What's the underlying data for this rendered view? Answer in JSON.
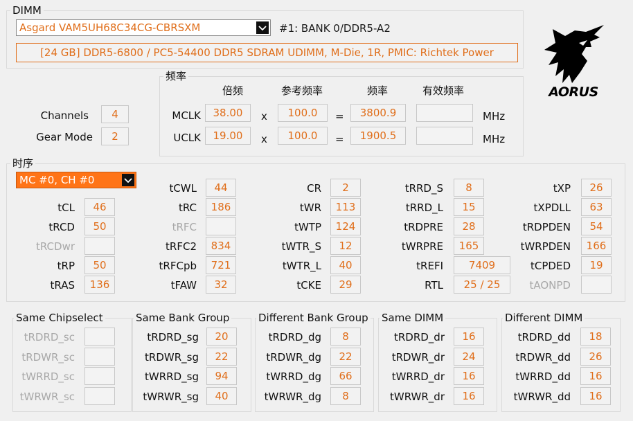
{
  "dimm": {
    "title": "DIMM",
    "module_select": "Asgard VAM5UH68C34CG-CBRSXM",
    "slot": "#1: BANK 0/DDR5-A2",
    "description": "[24 GB] DDR5-6800 / PC5-54400 DDR5 SDRAM UDIMM, M-Die, 1R, PMIC: Richtek Power"
  },
  "logo": {
    "text": "AORUS"
  },
  "channels": {
    "label": "Channels",
    "value": "4"
  },
  "gear_mode": {
    "label": "Gear Mode",
    "value": "2"
  },
  "freq": {
    "title": "频率",
    "headers": [
      "倍频",
      "参考频率",
      "频率",
      "有效频率"
    ],
    "rows": [
      {
        "label": "MCLK",
        "mult": "38.00",
        "x": "x",
        "ref": "100.0",
        "eq": "=",
        "freq": "3800.9",
        "eff": "",
        "unit": "MHz"
      },
      {
        "label": "UCLK",
        "mult": "19.00",
        "x": "x",
        "ref": "100.0",
        "eq": "=",
        "freq": "1900.5",
        "eff": "",
        "unit": "MHz"
      }
    ]
  },
  "timings": {
    "title": "时序",
    "mc_select": "MC #0, CH #0",
    "col1": [
      {
        "label": "tCL",
        "value": "46",
        "enabled": true
      },
      {
        "label": "tRCD",
        "value": "50",
        "enabled": true
      },
      {
        "label": "tRCDwr",
        "value": "",
        "enabled": false
      },
      {
        "label": "tRP",
        "value": "50",
        "enabled": true
      },
      {
        "label": "tRAS",
        "value": "136",
        "enabled": true
      }
    ],
    "col2": [
      {
        "label": "tCWL",
        "value": "44",
        "enabled": true
      },
      {
        "label": "tRC",
        "value": "186",
        "enabled": true
      },
      {
        "label": "tRFC",
        "value": "",
        "enabled": false
      },
      {
        "label": "tRFC2",
        "value": "834",
        "enabled": true
      },
      {
        "label": "tRFCpb",
        "value": "721",
        "enabled": true
      },
      {
        "label": "tFAW",
        "value": "32",
        "enabled": true
      }
    ],
    "col3": [
      {
        "label": "CR",
        "value": "2",
        "enabled": true
      },
      {
        "label": "tWR",
        "value": "113",
        "enabled": true
      },
      {
        "label": "tWTP",
        "value": "124",
        "enabled": true
      },
      {
        "label": "tWTR_S",
        "value": "12",
        "enabled": true
      },
      {
        "label": "tWTR_L",
        "value": "40",
        "enabled": true
      },
      {
        "label": "tCKE",
        "value": "29",
        "enabled": true
      }
    ],
    "col4": [
      {
        "label": "tRRD_S",
        "value": "8",
        "enabled": true
      },
      {
        "label": "tRRD_L",
        "value": "15",
        "enabled": true
      },
      {
        "label": "tRDPRE",
        "value": "28",
        "enabled": true
      },
      {
        "label": "tWRPRE",
        "value": "165",
        "enabled": true
      },
      {
        "label": "tREFI",
        "value": "7409",
        "enabled": true
      },
      {
        "label": "RTL",
        "value": "25 / 25",
        "enabled": true
      }
    ],
    "col5": [
      {
        "label": "tXP",
        "value": "26",
        "enabled": true
      },
      {
        "label": "tXPDLL",
        "value": "63",
        "enabled": true
      },
      {
        "label": "tRDPDEN",
        "value": "54",
        "enabled": true
      },
      {
        "label": "tWRPDEN",
        "value": "166",
        "enabled": true
      },
      {
        "label": "tCPDED",
        "value": "19",
        "enabled": true
      },
      {
        "label": "tAONPD",
        "value": "",
        "enabled": false
      }
    ]
  },
  "turnaround": [
    {
      "title": "Same Chipselect",
      "rows": [
        {
          "label": "tRDRD_sc",
          "value": "",
          "enabled": false
        },
        {
          "label": "tRDWR_sc",
          "value": "",
          "enabled": false
        },
        {
          "label": "tWRRD_sc",
          "value": "",
          "enabled": false
        },
        {
          "label": "tWRWR_sc",
          "value": "",
          "enabled": false
        }
      ]
    },
    {
      "title": "Same Bank Group",
      "rows": [
        {
          "label": "tRDRD_sg",
          "value": "20",
          "enabled": true
        },
        {
          "label": "tRDWR_sg",
          "value": "22",
          "enabled": true
        },
        {
          "label": "tWRRD_sg",
          "value": "94",
          "enabled": true
        },
        {
          "label": "tWRWR_sg",
          "value": "40",
          "enabled": true
        }
      ]
    },
    {
      "title": "Different Bank Group",
      "rows": [
        {
          "label": "tRDRD_dg",
          "value": "8",
          "enabled": true
        },
        {
          "label": "tRDWR_dg",
          "value": "22",
          "enabled": true
        },
        {
          "label": "tWRRD_dg",
          "value": "66",
          "enabled": true
        },
        {
          "label": "tWRWR_dg",
          "value": "8",
          "enabled": true
        }
      ]
    },
    {
      "title": "Same DIMM",
      "rows": [
        {
          "label": "tRDRD_dr",
          "value": "16",
          "enabled": true
        },
        {
          "label": "tRDWR_dr",
          "value": "24",
          "enabled": true
        },
        {
          "label": "tWRRD_dr",
          "value": "16",
          "enabled": true
        },
        {
          "label": "tWRWR_dr",
          "value": "16",
          "enabled": true
        }
      ]
    },
    {
      "title": "Different DIMM",
      "rows": [
        {
          "label": "tRDRD_dd",
          "value": "18",
          "enabled": true
        },
        {
          "label": "tRDWR_dd",
          "value": "26",
          "enabled": true
        },
        {
          "label": "tWRRD_dd",
          "value": "16",
          "enabled": true
        },
        {
          "label": "tWRWR_dd",
          "value": "16",
          "enabled": true
        }
      ]
    }
  ],
  "colors": {
    "value": "#e06e1a",
    "accent": "#ff7417",
    "disabled": "#a8a8a8"
  },
  "icons": [
    "chevron-down-icon",
    "aorus-eagle-logo"
  ]
}
